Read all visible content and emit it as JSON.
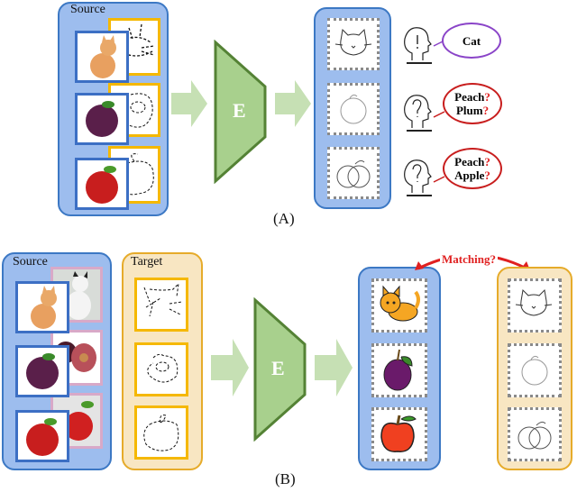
{
  "panel_a": {
    "source_title": "Source",
    "encoder_label": "E",
    "caption": "(A)",
    "source_items": [
      {
        "photo": "cat-photo",
        "sketch": "cat-sketch"
      },
      {
        "photo": "plum-photo",
        "sketch": "plum-sketch"
      },
      {
        "photo": "apple-photo",
        "sketch": "apple-sketch"
      }
    ],
    "output_items": [
      "cat-sketch",
      "peach-sketch",
      "apple-peach-sketch"
    ],
    "predictions": [
      {
        "lines": [
          {
            "text": "Cat",
            "q": ""
          }
        ],
        "head": "exclamation",
        "bubble_color": "#8a44c8"
      },
      {
        "lines": [
          {
            "text": "Peach",
            "q": "?"
          },
          {
            "text": "Plum",
            "q": "?"
          }
        ],
        "head": "question",
        "bubble_color": "#c81e1e"
      },
      {
        "lines": [
          {
            "text": "Peach",
            "q": "?"
          },
          {
            "text": "Apple",
            "q": "?"
          }
        ],
        "head": "question",
        "bubble_color": "#c81e1e"
      }
    ]
  },
  "panel_b": {
    "source_title": "Source",
    "target_title": "Target",
    "encoder_label": "E",
    "caption": "(B)",
    "matching_label": "Matching?",
    "source_items": [
      "cat-photo",
      "plum-photo",
      "apple-photo"
    ],
    "source_back_items": [
      "cat-painting",
      "plum-painting",
      "apple-painting"
    ],
    "target_items": [
      "cat-sketch",
      "plum-sketch",
      "apple-sketch"
    ],
    "output_items": [
      "cat-cartoon",
      "plum-cartoon",
      "apple-cartoon"
    ],
    "target_output_items": [
      "cat-sketch",
      "peach-sketch",
      "apple-peach-sketch"
    ]
  },
  "colors": {
    "source_fill": "#9dbdee",
    "source_border": "#3c78c4",
    "target_fill": "#f8e6c2",
    "target_border": "#e6ab2a",
    "encoder_fill": "#a8d08d",
    "encoder_border": "#548235",
    "arrow_fill": "#c6e0b4",
    "matching_red": "#e02020"
  }
}
